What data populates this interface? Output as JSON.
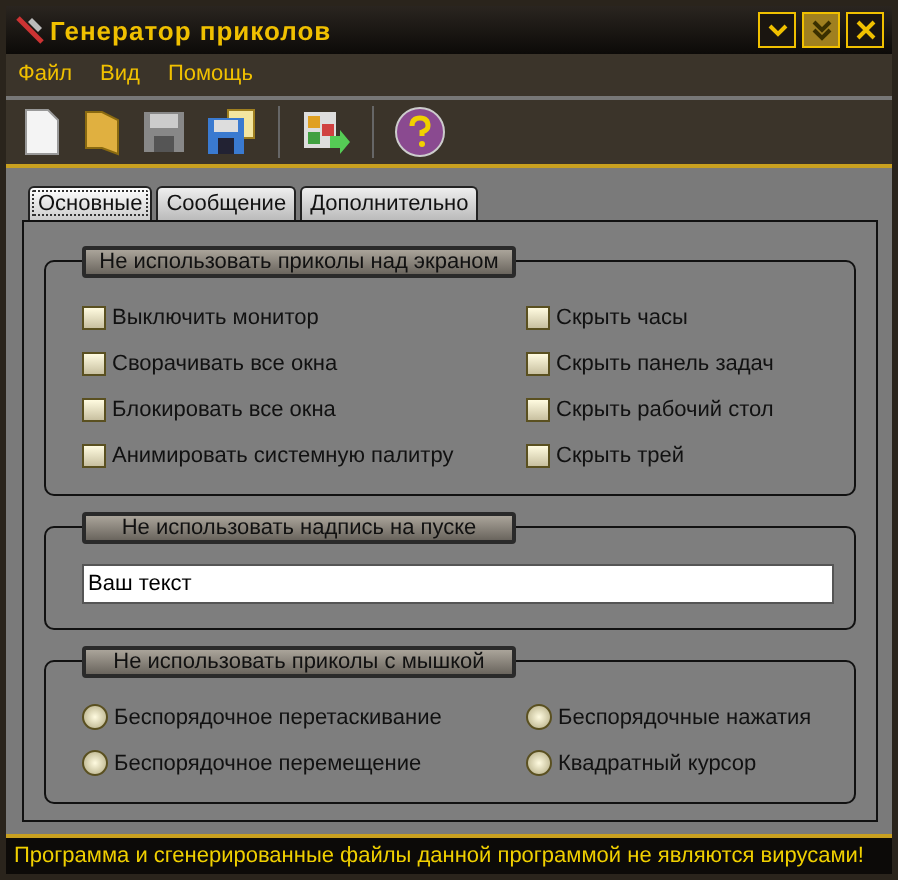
{
  "window": {
    "title": "Генератор приколов"
  },
  "menu": [
    "Файл",
    "Вид",
    "Помощь"
  ],
  "tabs": [
    {
      "label": "Основные",
      "selected": true
    },
    {
      "label": "Сообщение",
      "selected": false
    },
    {
      "label": "Дополнительно",
      "selected": false
    }
  ],
  "screen_group": {
    "title": "Не использовать приколы над экраном",
    "columns": [
      [
        {
          "label": "Выключить монитор",
          "checked": false
        },
        {
          "label": "Сворачивать все окна",
          "checked": false
        },
        {
          "label": "Блокировать все окна",
          "checked": false
        },
        {
          "label": "Анимировать системную палитру",
          "checked": false
        }
      ],
      [
        {
          "label": "Скрыть часы",
          "checked": false
        },
        {
          "label": "Скрыть панель задач",
          "checked": false
        },
        {
          "label": "Скрыть рабочий стол",
          "checked": false
        },
        {
          "label": "Скрыть трей",
          "checked": false
        }
      ]
    ]
  },
  "start_group": {
    "title": "Не использовать надпись на пуске",
    "value": "Ваш текст"
  },
  "mouse_group": {
    "title": "Не использовать приколы с мышкой",
    "columns": [
      [
        {
          "label": "Беспорядочное перетаскивание",
          "selected": false
        },
        {
          "label": "Беспорядочное перемещение",
          "selected": false
        }
      ],
      [
        {
          "label": "Беспорядочные нажатия",
          "selected": false
        },
        {
          "label": "Квадратный курсор",
          "selected": false
        }
      ]
    ]
  },
  "status_bar": "Программа и сгенерированные файлы данной программой не являются вирусами!"
}
